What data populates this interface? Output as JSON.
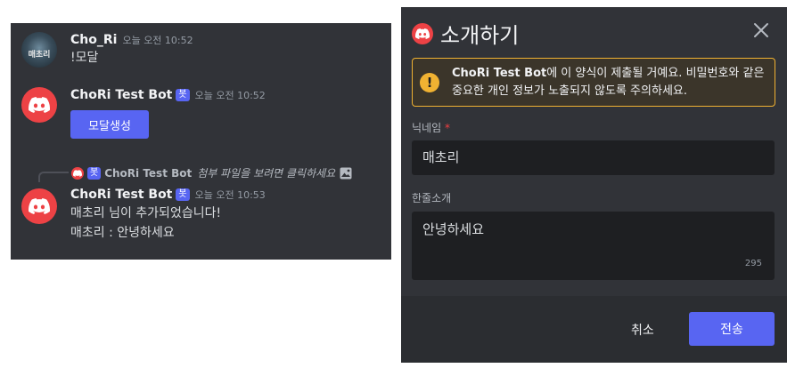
{
  "chat": {
    "messages": [
      {
        "author": "Cho_Ri",
        "avatar_text": "매초리",
        "timestamp": "오늘 오전 10:52",
        "text": "!모달"
      },
      {
        "author": "ChoRi Test Bot",
        "badge": "봇",
        "timestamp": "오늘 오전 10:52",
        "button_label": "모달생성"
      },
      {
        "reply": {
          "badge": "봇",
          "author": "ChoRi Test Bot",
          "text": "첨부 파일을 보려면 클릭하세요"
        },
        "author": "ChoRi Test Bot",
        "badge": "봇",
        "timestamp": "오늘 오전 10:53",
        "lines": [
          "매초리 님이 추가되었습니다!",
          "매초리 : 안녕하세요"
        ]
      }
    ]
  },
  "modal": {
    "title": "소개하기",
    "warning": {
      "bot_name": "ChoRi Test Bot",
      "text": "에 이 양식이 제출될 거예요. 비밀번호와 같은 중요한 개인 정보가 노출되지 않도록 주의하세요."
    },
    "fields": [
      {
        "label": "닉네임",
        "required_mark": "*",
        "value": "매초리"
      },
      {
        "label": "한줄소개",
        "value": "안녕하세요",
        "remaining": "295"
      }
    ],
    "cancel_label": "취소",
    "submit_label": "전송"
  },
  "colors": {
    "background": "#313338",
    "blurple": "#5865f2",
    "bot_avatar": "#ed4245",
    "warning_border": "#f0b232"
  }
}
